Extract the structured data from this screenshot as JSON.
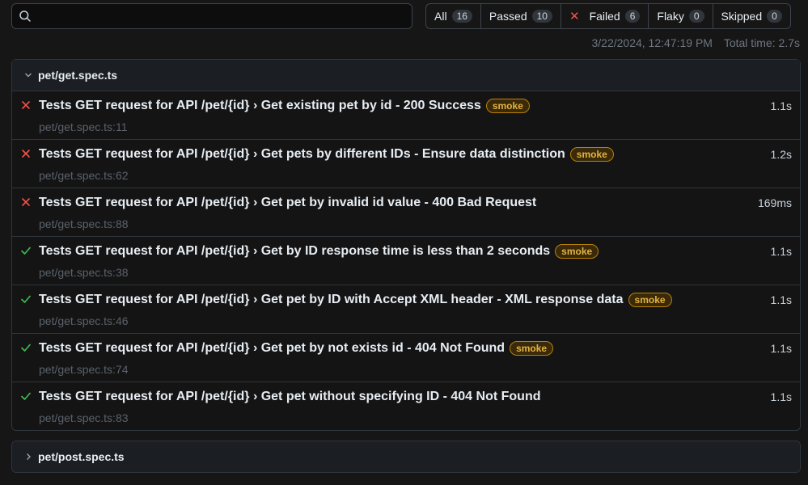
{
  "search": {
    "value": "",
    "placeholder": ""
  },
  "filters": [
    {
      "label": "All",
      "count": "16"
    },
    {
      "label": "Passed",
      "count": "10"
    },
    {
      "label": "Failed",
      "count": "6"
    },
    {
      "label": "Flaky",
      "count": "0"
    },
    {
      "label": "Skipped",
      "count": "0"
    }
  ],
  "meta": {
    "timestamp": "3/22/2024, 12:47:19 PM",
    "total_time": "Total time: 2.7s"
  },
  "colors": {
    "failed": "#f85149",
    "passed": "#3fb950",
    "badge": "#e3b341"
  },
  "files": [
    {
      "name": "pet/get.spec.ts",
      "expanded": true,
      "tests": [
        {
          "status": "failed",
          "title": "Tests GET request for API /pet/{id} › Get existing pet by id - 200 Success",
          "badge": "smoke",
          "location": "pet/get.spec.ts:11",
          "duration": "1.1s"
        },
        {
          "status": "failed",
          "title": "Tests GET request for API /pet/{id} › Get pets by different IDs - Ensure data distinction",
          "badge": "smoke",
          "location": "pet/get.spec.ts:62",
          "duration": "1.2s"
        },
        {
          "status": "failed",
          "title": "Tests GET request for API /pet/{id} › Get pet by invalid id value - 400 Bad Request",
          "badge": "",
          "location": "pet/get.spec.ts:88",
          "duration": "169ms"
        },
        {
          "status": "passed",
          "title": "Tests GET request for API /pet/{id} › Get by ID response time is less than 2 seconds",
          "badge": "smoke",
          "location": "pet/get.spec.ts:38",
          "duration": "1.1s"
        },
        {
          "status": "passed",
          "title": "Tests GET request for API /pet/{id} › Get pet by ID with Accept XML header - XML response data",
          "badge": "smoke",
          "location": "pet/get.spec.ts:46",
          "duration": "1.1s"
        },
        {
          "status": "passed",
          "title": "Tests GET request for API /pet/{id} › Get pet by not exists id - 404 Not Found",
          "badge": "smoke",
          "location": "pet/get.spec.ts:74",
          "duration": "1.1s"
        },
        {
          "status": "passed",
          "title": "Tests GET request for API /pet/{id} › Get pet without specifying ID - 404 Not Found",
          "badge": "",
          "location": "pet/get.spec.ts:83",
          "duration": "1.1s"
        }
      ]
    },
    {
      "name": "pet/post.spec.ts",
      "expanded": false,
      "tests": []
    }
  ]
}
